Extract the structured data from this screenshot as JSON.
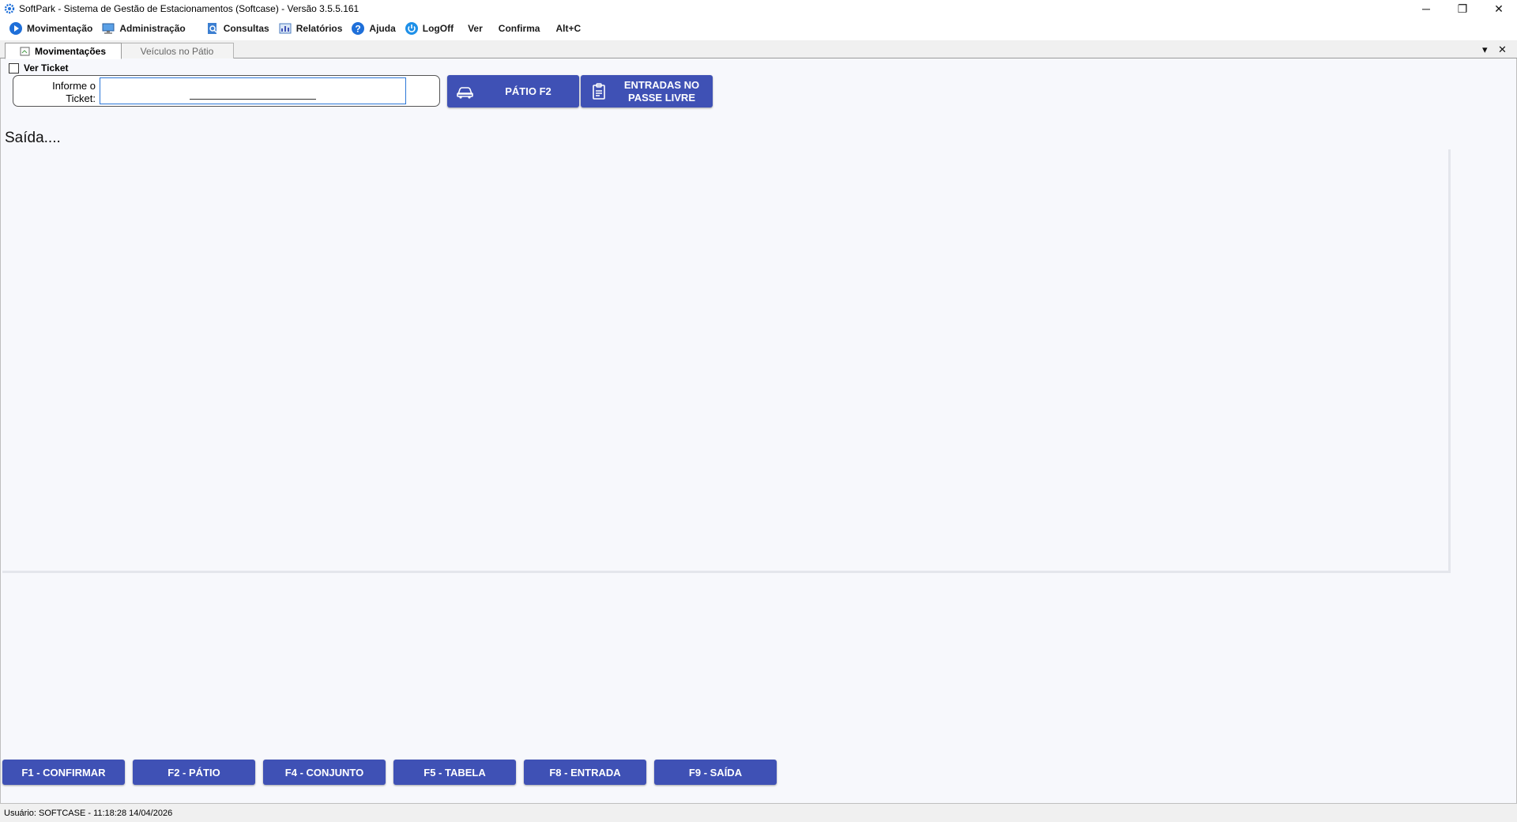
{
  "window": {
    "title": "SoftPark - Sistema de Gestão de Estacionamentos (Softcase) - Versão 3.5.5.161",
    "controls": {
      "minimize": "─",
      "restore": "❐",
      "close": "✕"
    }
  },
  "menu": {
    "items": [
      {
        "label": "Movimentação",
        "icon": "play-icon"
      },
      {
        "label": "Administração",
        "icon": "monitor-icon"
      },
      {
        "label": "Consultas",
        "icon": "search-doc-icon"
      },
      {
        "label": "Relatórios",
        "icon": "report-icon"
      },
      {
        "label": "Ajuda",
        "icon": "help-icon"
      },
      {
        "label": "LogOff",
        "icon": "power-icon"
      },
      {
        "label": "Ver"
      },
      {
        "label": "Confirma"
      },
      {
        "label": "Alt+C"
      }
    ]
  },
  "tabs": {
    "items": [
      {
        "label": "Movimentações",
        "active": true
      },
      {
        "label": "Veículos no Pátio",
        "active": false
      }
    ],
    "dropdown": "▾",
    "close": "✕"
  },
  "main": {
    "ver_ticket": "Ver Ticket",
    "ticket_label_line1": "Informe o",
    "ticket_label_line2": "Ticket:",
    "ticket_value": "",
    "patio_button": "PÁTIO F2",
    "entradas_button_line1": "ENTRADAS NO",
    "entradas_button_line2": "PASSE LIVRE",
    "saida_label": "Saída...."
  },
  "fkeys": [
    "F1 - CONFIRMAR",
    "F2 - PÁTIO",
    "F4 - CONJUNTO",
    "F5 - TABELA",
    "F8 - ENTRADA",
    "F9 - SAÍDA"
  ],
  "status": {
    "text": "Usuário:  SOFTCASE - 11:18:28 14/04/2026"
  },
  "colors": {
    "accent": "#3f51b5",
    "background": "#f7f8fc",
    "input_border": "#2c77d8"
  }
}
